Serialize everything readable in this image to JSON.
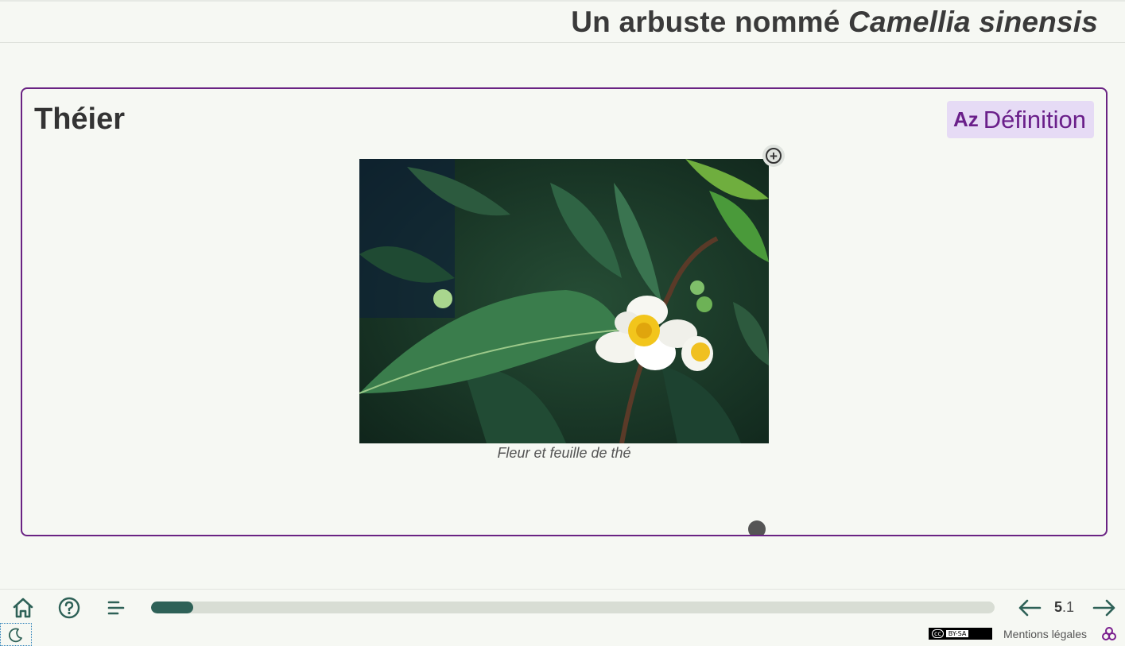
{
  "header": {
    "title_plain": "Un arbuste nommé ",
    "title_italic": "Camellia sinensis"
  },
  "card": {
    "title": "Théier",
    "badge_icon": "Az",
    "badge_label": "Définition",
    "figure_caption": "Fleur et feuille de thé",
    "zoom_icon": "zoom-in-icon"
  },
  "footer": {
    "home_icon": "home-icon",
    "help_icon": "help-icon",
    "menu_icon": "menu-icon",
    "progress_fraction": 0.05,
    "page_main": "5",
    "page_sub": ".1",
    "prev_icon": "arrow-left-icon",
    "next_icon": "arrow-right-icon",
    "theme_icon": "moon-icon",
    "license_cc": "cc",
    "license_text": "BY-SA",
    "legal_label": "Mentions légales"
  },
  "colors": {
    "accent": "#6a2383",
    "teal": "#2e6157",
    "badge_bg": "#e6dbf5",
    "progress_track": "#d8ddd4",
    "background": "#f6f8f3"
  }
}
